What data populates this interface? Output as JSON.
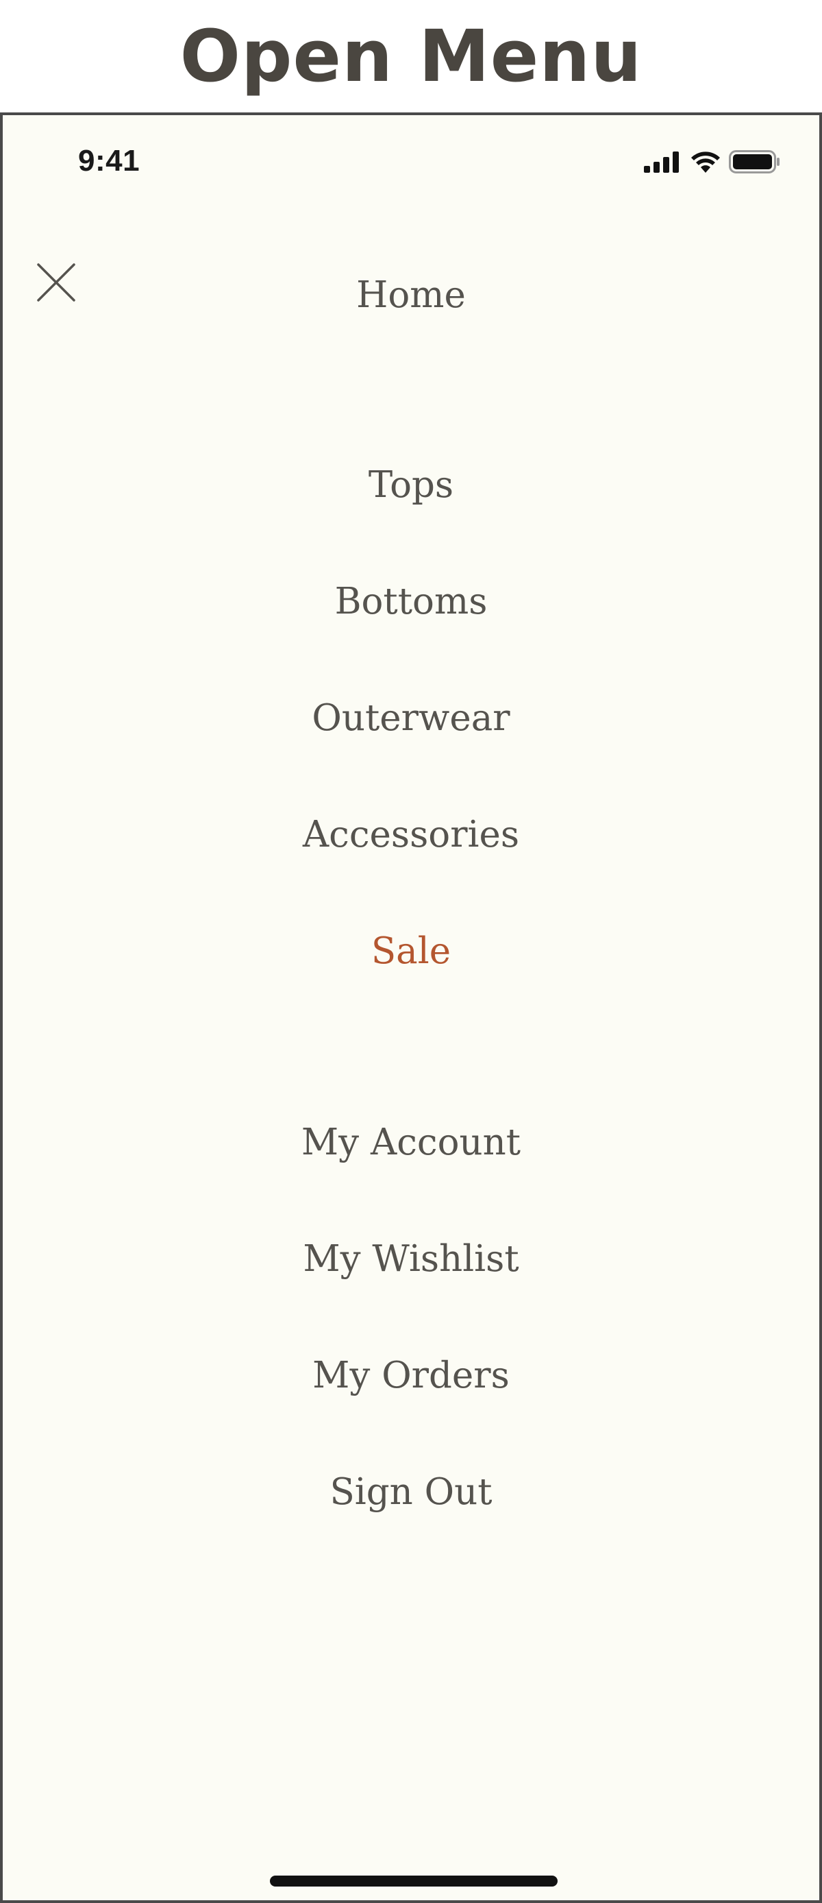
{
  "heading": "Open Menu",
  "status_bar": {
    "time": "9:41",
    "icons": [
      "cellular-signal-icon",
      "wifi-icon",
      "battery-icon"
    ]
  },
  "close_icon": "close-icon",
  "menu": {
    "home": "Home",
    "categories": [
      "Tops",
      "Bottoms",
      "Outerwear",
      "Accessories",
      "Sale"
    ],
    "account": [
      "My Account",
      "My Wishlist",
      "My Orders",
      "Sign Out"
    ]
  },
  "colors": {
    "background": "#fcfcf5",
    "text": "#55534e",
    "sale": "#b4562f",
    "heading": "#4a4640",
    "frame": "#4a4a4a"
  }
}
